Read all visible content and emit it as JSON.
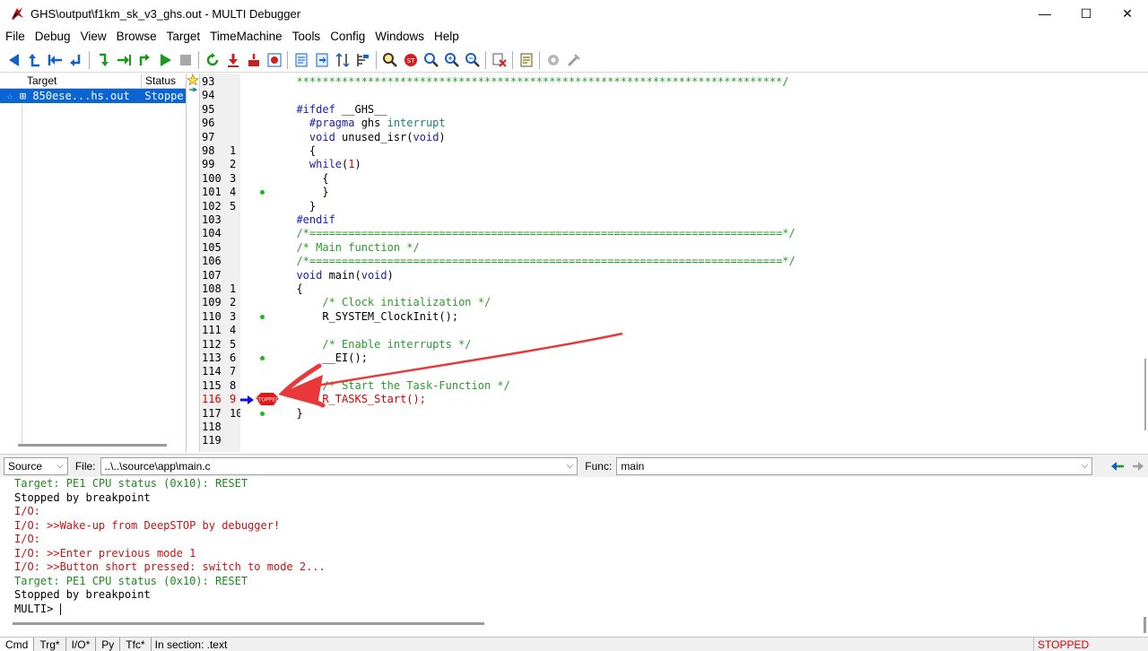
{
  "window": {
    "title": "GHS\\output\\f1km_sk_v3_ghs.out - MULTI Debugger",
    "minimize": "—",
    "maximize": "☐",
    "close": "✕"
  },
  "menu": [
    "File",
    "Debug",
    "View",
    "Browse",
    "Target",
    "TimeMachine",
    "Tools",
    "Config",
    "Windows",
    "Help"
  ],
  "target_pane": {
    "col_target": "Target",
    "col_status": "Status",
    "row": {
      "name": "⊞ 850ese...hs.out",
      "status": "Stoppe"
    }
  },
  "source": {
    "lines": [
      {
        "ln": "93",
        "blk": "",
        "text": "  ***************************************************************************/",
        "cls": "c-green"
      },
      {
        "ln": "94",
        "blk": "",
        "text": "",
        "cls": ""
      },
      {
        "ln": "95",
        "blk": "",
        "text": "  #ifdef __GHS__",
        "cls": "mix-ifdef"
      },
      {
        "ln": "96",
        "blk": "",
        "text": "    #pragma ghs interrupt",
        "cls": "mix-pragma"
      },
      {
        "ln": "97",
        "blk": "",
        "text": "    void unused_isr(void)",
        "cls": "mix-voidfn"
      },
      {
        "ln": "98",
        "blk": "1",
        "text": "    {",
        "cls": ""
      },
      {
        "ln": "99",
        "blk": "2",
        "text": "    while(1)",
        "cls": "mix-while"
      },
      {
        "ln": "100",
        "blk": "3",
        "text": "      {",
        "cls": ""
      },
      {
        "ln": "101",
        "blk": "4",
        "text": "      }",
        "cls": ""
      },
      {
        "ln": "102",
        "blk": "5",
        "text": "    }",
        "cls": ""
      },
      {
        "ln": "103",
        "blk": "",
        "text": "  #endif",
        "cls": "c-kw"
      },
      {
        "ln": "104",
        "blk": "",
        "text": "  /*=========================================================================*/",
        "cls": "c-green"
      },
      {
        "ln": "105",
        "blk": "",
        "text": "  /* Main function */",
        "cls": "c-green"
      },
      {
        "ln": "106",
        "blk": "",
        "text": "  /*=========================================================================*/",
        "cls": "c-green"
      },
      {
        "ln": "107",
        "blk": "",
        "text": "  void main(void)",
        "cls": "mix-main"
      },
      {
        "ln": "108",
        "blk": "1",
        "text": "  {",
        "cls": ""
      },
      {
        "ln": "109",
        "blk": "2",
        "text": "      /* Clock initialization */",
        "cls": "c-green"
      },
      {
        "ln": "110",
        "blk": "3",
        "text": "      R_SYSTEM_ClockInit();",
        "cls": ""
      },
      {
        "ln": "111",
        "blk": "4",
        "text": "",
        "cls": ""
      },
      {
        "ln": "112",
        "blk": "5",
        "text": "      /* Enable interrupts */",
        "cls": "c-green"
      },
      {
        "ln": "113",
        "blk": "6",
        "text": "      __EI();",
        "cls": ""
      },
      {
        "ln": "114",
        "blk": "7",
        "text": "",
        "cls": ""
      },
      {
        "ln": "115",
        "blk": "8",
        "text": "      /* Start the Task-Function */",
        "cls": "c-green"
      },
      {
        "ln": "116",
        "blk": "9",
        "text": "      R_TASKS_Start();",
        "cls": "c-red"
      },
      {
        "ln": "117",
        "blk": "10",
        "text": "  }",
        "cls": ""
      },
      {
        "ln": "118",
        "blk": "",
        "text": "",
        "cls": ""
      },
      {
        "ln": "119",
        "blk": "",
        "text": "",
        "cls": ""
      }
    ],
    "dots_on": [
      "101",
      "110",
      "113",
      "117"
    ],
    "current_line": "116",
    "stop_badge": "STOPPED"
  },
  "locbar": {
    "view_mode": "Source",
    "file_label": "File:",
    "file_value": "..\\..\\source\\app\\main.c",
    "func_label": "Func:",
    "func_value": "main"
  },
  "cmd_lines": [
    {
      "text": "Target: PE1 CPU status (0x10): RESET",
      "cls": "cmd-green"
    },
    {
      "text": "Stopped by breakpoint",
      "cls": "cmd-black"
    },
    {
      "text": "I/O:",
      "cls": "cmd-red"
    },
    {
      "text": "I/O: >>Wake-up from DeepSTOP by debugger!",
      "cls": "cmd-red"
    },
    {
      "text": "I/O:",
      "cls": "cmd-red"
    },
    {
      "text": "I/O: >>Enter previous mode 1",
      "cls": "cmd-red"
    },
    {
      "text": "I/O: >>Button short pressed: switch to mode 2...",
      "cls": "cmd-red"
    },
    {
      "text": "Target: PE1 CPU status (0x10): RESET",
      "cls": "cmd-green"
    },
    {
      "text": "Stopped by breakpoint",
      "cls": "cmd-black"
    },
    {
      "text": "MULTI> ",
      "cls": "cmd-black"
    }
  ],
  "tabs": [
    "Cmd",
    "Trg*",
    "I/O*",
    "Py",
    "Tfc*"
  ],
  "section_text": "In section: .text",
  "status_text": "STOPPED"
}
